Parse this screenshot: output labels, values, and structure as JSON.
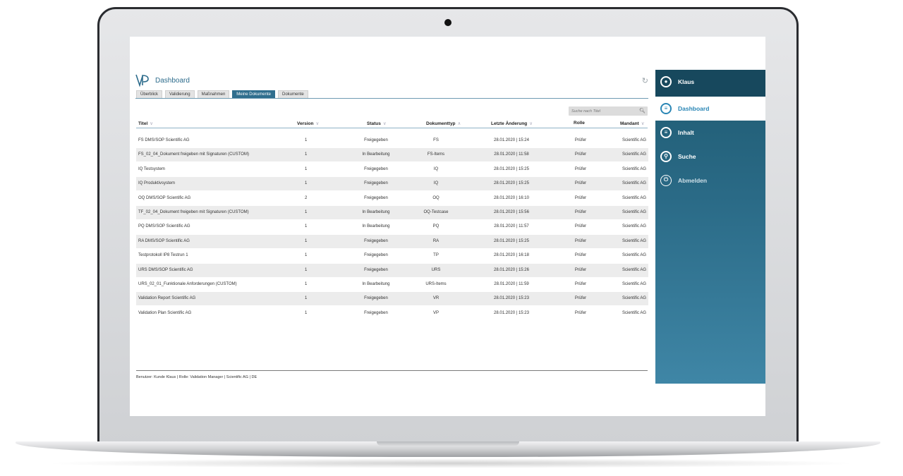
{
  "app": {
    "title": "Dashboard",
    "tabs": [
      "Überblick",
      "Validierung",
      "Maßnahmen",
      "Meine Dokumente",
      "Dokumente"
    ],
    "active_tab": 3,
    "search_placeholder": "Suche nach Titel",
    "columns": {
      "title": "Titel",
      "version": "Version",
      "status": "Status",
      "doctype": "Dokumenttyp",
      "changed": "Letzte Änderung",
      "role": "Rolle",
      "client": "Mandant"
    },
    "rows": [
      {
        "title": "FS DMS/SOP Scientific AG",
        "version": "1",
        "status": "Freigegeben",
        "doctype": "FS",
        "changed": "28.01.2020 | 15:24",
        "role": "Prüfer",
        "client": "Scientific AG"
      },
      {
        "title": "FS_02_04_Dokument freigeben mit Signaturen (CUSTOM)",
        "version": "1",
        "status": "In Bearbeitung",
        "doctype": "FS-Items",
        "changed": "28.01.2020 | 11:58",
        "role": "Prüfer",
        "client": "Scientific AG"
      },
      {
        "title": "IQ Testsystem",
        "version": "1",
        "status": "Freigegeben",
        "doctype": "IQ",
        "changed": "28.01.2020 | 15:25",
        "role": "Prüfer",
        "client": "Scientific AG"
      },
      {
        "title": "IQ Produktivsystem",
        "version": "1",
        "status": "Freigegeben",
        "doctype": "IQ",
        "changed": "28.01.2020 | 15:25",
        "role": "Prüfer",
        "client": "Scientific AG"
      },
      {
        "title": "OQ DMS/SOP Scientific AG",
        "version": "2",
        "status": "Freigegeben",
        "doctype": "OQ",
        "changed": "28.01.2020 | 16:10",
        "role": "Prüfer",
        "client": "Scientific AG"
      },
      {
        "title": "TF_02_04_Dokument freigeben mit Signaturen (CUSTOM)",
        "version": "1",
        "status": "In Bearbeitung",
        "doctype": "OQ-Testcase",
        "changed": "28.01.2020 | 15:56",
        "role": "Prüfer",
        "client": "Scientific AG"
      },
      {
        "title": "PQ DMS/SOP Scientific AG",
        "version": "1",
        "status": "In Bearbeitung",
        "doctype": "PQ",
        "changed": "28.01.2020 | 11:57",
        "role": "Prüfer",
        "client": "Scientific AG"
      },
      {
        "title": "RA DMS/SOP Scientific AG",
        "version": "1",
        "status": "Freigegeben",
        "doctype": "RA",
        "changed": "28.01.2020 | 15:25",
        "role": "Prüfer",
        "client": "Scientific AG"
      },
      {
        "title": "Testprotokoll IP8 Testrun 1",
        "version": "1",
        "status": "Freigegeben",
        "doctype": "TP",
        "changed": "28.01.2020 | 16:18",
        "role": "Prüfer",
        "client": "Scientific AG"
      },
      {
        "title": "URS DMS/SOP Scientific AG",
        "version": "1",
        "status": "Freigegeben",
        "doctype": "URS",
        "changed": "28.01.2020 | 15:26",
        "role": "Prüfer",
        "client": "Scientific AG"
      },
      {
        "title": "URS_02_01_Funktionale Anforderungen (CUSTOM)",
        "version": "1",
        "status": "In Bearbeitung",
        "doctype": "URS-Items",
        "changed": "28.01.2020 | 11:59",
        "role": "Prüfer",
        "client": "Scientific AG"
      },
      {
        "title": "Validation Report Scientific AG",
        "version": "1",
        "status": "Freigegeben",
        "doctype": "VR",
        "changed": "28.01.2020 | 15:23",
        "role": "Prüfer",
        "client": "Scientific AG"
      },
      {
        "title": "Validation Plan Scientific AG",
        "version": "1",
        "status": "Freigegeben",
        "doctype": "VP",
        "changed": "28.01.2020 | 15:23",
        "role": "Prüfer",
        "client": "Scientific AG"
      }
    ],
    "footer": "Benutzer: Kunde Klaus | Rolle: Validation Manager | Scientific AG | DE"
  },
  "sidebar": {
    "user": "Klaus",
    "items": [
      {
        "label": "Dashboard",
        "icon": "list-icon"
      },
      {
        "label": "Inhalt",
        "icon": "document-icon"
      },
      {
        "label": "Suche",
        "icon": "search-icon"
      },
      {
        "label": "Abmelden",
        "icon": "power-icon"
      }
    ]
  },
  "colors": {
    "accent": "#2f6e8e",
    "sidebar_dark": "#17485d",
    "sidebar_light": "#3f86a6",
    "active_blue": "#2a86b5"
  }
}
